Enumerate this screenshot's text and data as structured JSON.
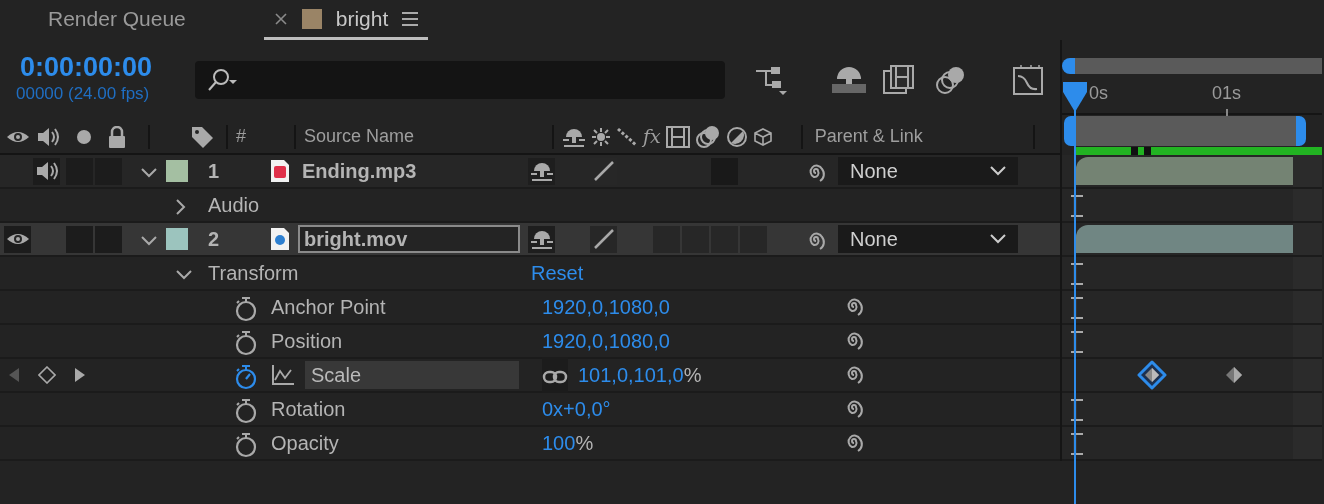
{
  "tabs": [
    {
      "label": "Render Queue",
      "selected": false,
      "closable": false,
      "menu": false
    },
    {
      "label": "bright",
      "selected": true,
      "closable": true,
      "menu": true,
      "color": "#9a8466"
    }
  ],
  "timecode": "0:00:00:00",
  "frame_info": "00000 (24.00 fps)",
  "columns": {
    "number": "#",
    "source_name": "Source Name",
    "effects": "fx",
    "parent": "Parent & Link"
  },
  "ruler": [
    "0s",
    "01s"
  ],
  "layers": [
    {
      "number": "1",
      "name": "Ending.mp3",
      "color": "#a4bfa2",
      "kind": "audio",
      "video": false,
      "audio": true,
      "selected": false,
      "expanded": true,
      "parent": "None",
      "children": [
        {
          "kind": "group",
          "label": "Audio",
          "expanded": false
        }
      ]
    },
    {
      "number": "2",
      "name": "bright.mov",
      "color": "#9cc4be",
      "kind": "video",
      "video": true,
      "audio": false,
      "selected": true,
      "expanded": true,
      "parent": "None",
      "children": [
        {
          "kind": "group",
          "label": "Transform",
          "expanded": true,
          "action": "Reset",
          "children": [
            {
              "kind": "property",
              "name": "Anchor Point",
              "value": "1920,0,1080,0",
              "animated": false,
              "selected": false
            },
            {
              "kind": "property",
              "name": "Position",
              "value": "1920,0,1080,0",
              "animated": false,
              "selected": false
            },
            {
              "kind": "property",
              "name": "Scale",
              "value": "101,0,101,0",
              "unit": "%",
              "linked": true,
              "animated": true,
              "selected": true,
              "keyframes": [
                {
                  "selected": true
                },
                {
                  "selected": false
                }
              ]
            },
            {
              "kind": "property",
              "name": "Rotation",
              "value": "0x+0,0°",
              "animated": false,
              "selected": false
            },
            {
              "kind": "property",
              "name": "Opacity",
              "value": "100",
              "unit": "%",
              "animated": false,
              "selected": false
            }
          ]
        }
      ]
    }
  ]
}
